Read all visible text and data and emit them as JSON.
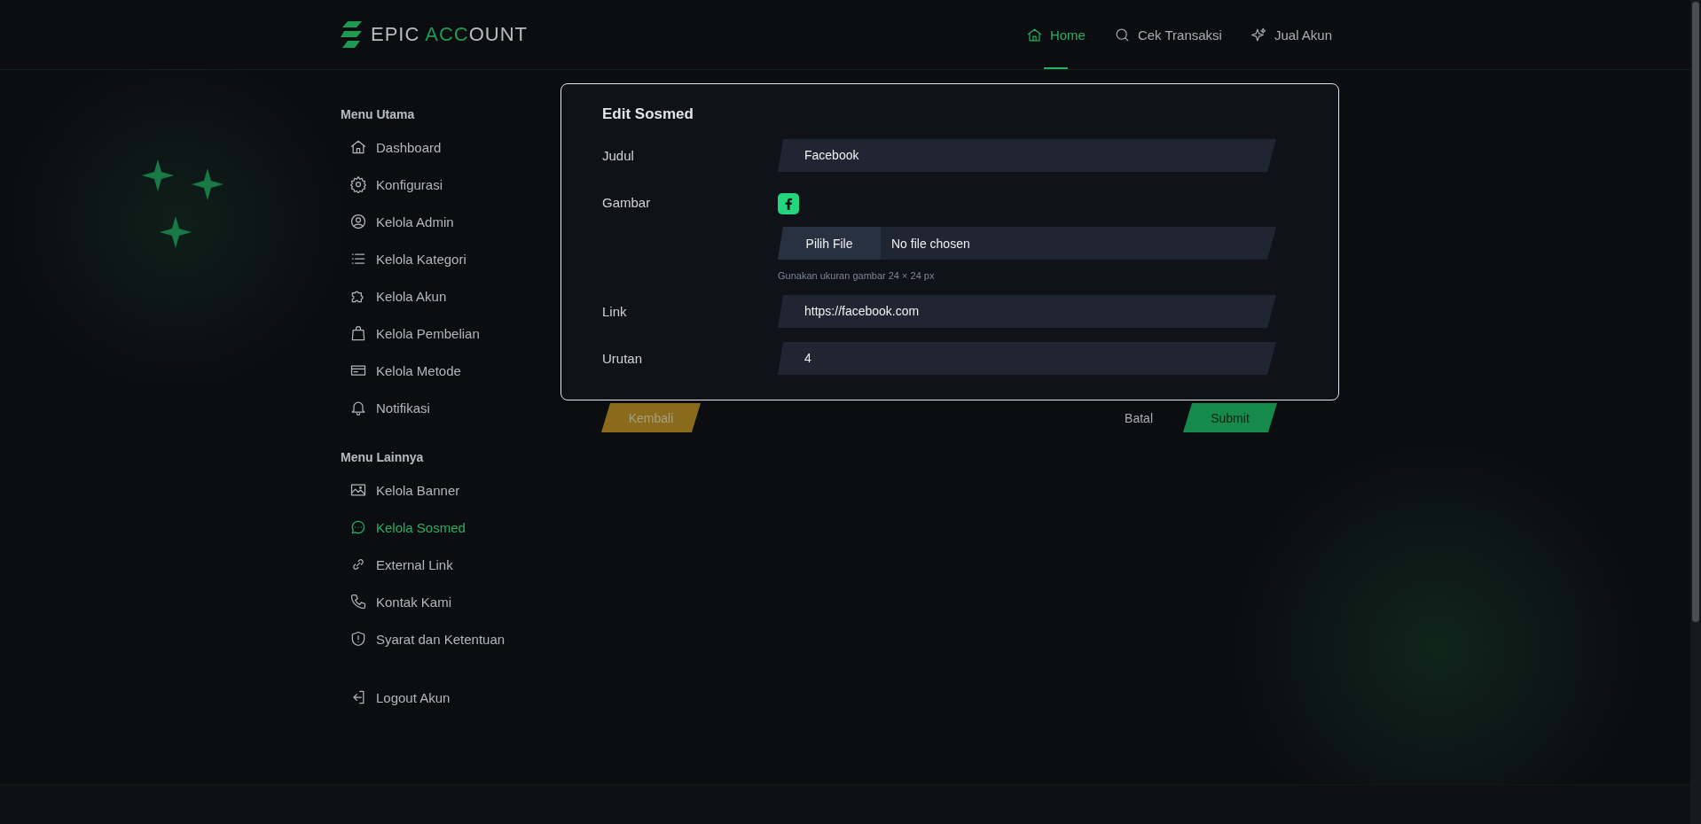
{
  "header": {
    "logo": [
      {
        "text": "EPIC ",
        "accent": false
      },
      {
        "text": "ACC",
        "accent": true
      },
      {
        "text": "OUNT",
        "accent": false
      }
    ],
    "nav": [
      {
        "label": "Home",
        "selected": true
      },
      {
        "label": "Cek Transaksi",
        "selected": false
      },
      {
        "label": "Jual Akun",
        "selected": false
      }
    ]
  },
  "sidebar": {
    "sections": [
      {
        "title": "Menu Utama",
        "items": [
          {
            "label": "Dashboard",
            "selected": false
          },
          {
            "label": "Konfigurasi",
            "selected": false
          },
          {
            "label": "Kelola Admin",
            "selected": false
          },
          {
            "label": "Kelola Kategori",
            "selected": false
          },
          {
            "label": "Kelola Akun",
            "selected": false
          },
          {
            "label": "Kelola Pembelian",
            "selected": false
          },
          {
            "label": "Kelola Metode",
            "selected": false
          },
          {
            "label": "Notifikasi",
            "selected": false
          }
        ]
      },
      {
        "title": "Menu Lainnya",
        "items": [
          {
            "label": "Kelola Banner",
            "selected": false
          },
          {
            "label": "Kelola Sosmed",
            "selected": true
          },
          {
            "label": "External Link",
            "selected": false
          },
          {
            "label": "Kontak Kami",
            "selected": false
          },
          {
            "label": "Syarat dan Ketentuan",
            "selected": false
          }
        ]
      }
    ],
    "logout": "Logout Akun"
  },
  "form": {
    "title": "Edit Sosmed",
    "fields": [
      {
        "kind": "text",
        "label": "Judul",
        "value": "Facebook"
      },
      {
        "kind": "image",
        "label": "Gambar",
        "button": "Pilih File",
        "file_status": "No file chosen",
        "hint": "Gunakan ukuran gambar 24 × 24 px"
      },
      {
        "kind": "text",
        "label": "Link",
        "value": "https://facebook.com"
      },
      {
        "kind": "text",
        "label": "Urutan",
        "value": "4"
      }
    ]
  },
  "actions": {
    "back": "Kembali",
    "cancel": "Batal",
    "submit": "Submit"
  }
}
